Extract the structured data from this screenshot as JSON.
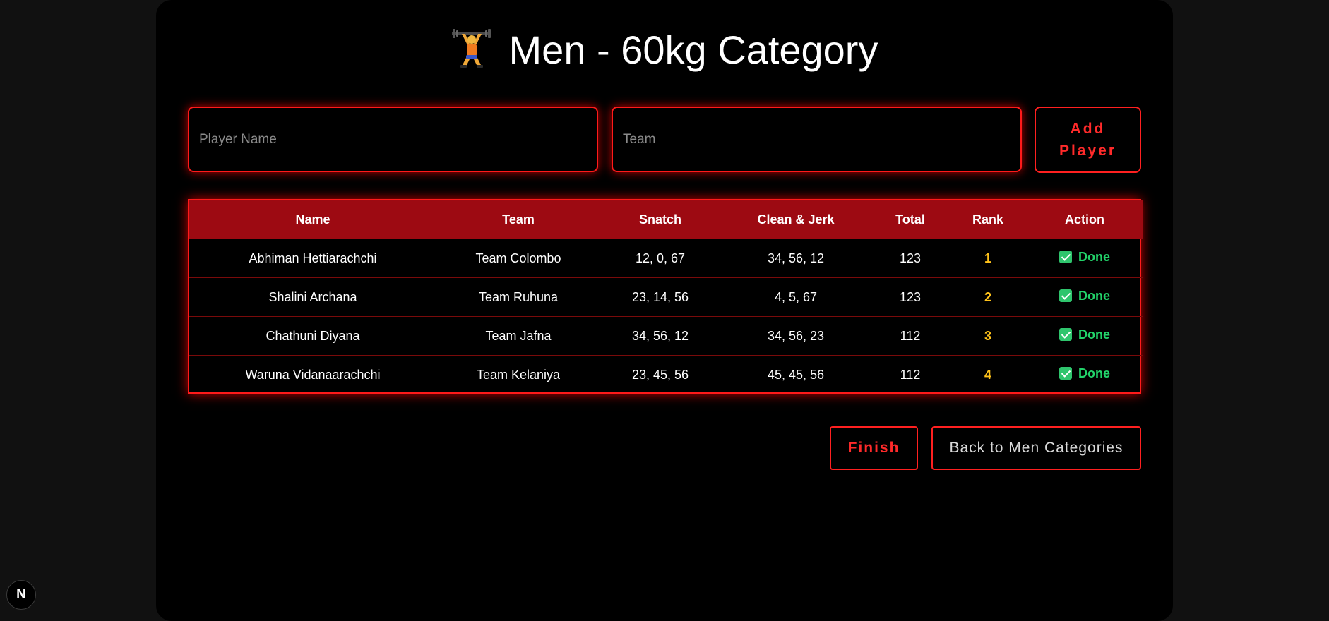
{
  "page": {
    "title": "Men - 60kg Category",
    "title_icon": "weightlifter-emoji"
  },
  "form": {
    "name_placeholder": "Player Name",
    "name_value": "",
    "team_placeholder": "Team",
    "team_value": "",
    "add_label": "Add Player"
  },
  "table": {
    "headers": [
      "Name",
      "Team",
      "Snatch",
      "Clean & Jerk",
      "Total",
      "Rank",
      "Action"
    ],
    "rows": [
      {
        "name": "Abhiman Hettiarachchi",
        "team": "Team Colombo",
        "snatch": "12, 0, 67",
        "clean_jerk": "34, 56, 12",
        "total": "123",
        "rank": "1",
        "action": "Done"
      },
      {
        "name": "Shalini Archana",
        "team": "Team Ruhuna",
        "snatch": "23, 14, 56",
        "clean_jerk": "4, 5, 67",
        "total": "123",
        "rank": "2",
        "action": "Done"
      },
      {
        "name": "Chathuni Diyana",
        "team": "Team Jafna",
        "snatch": "34, 56, 12",
        "clean_jerk": "34, 56, 23",
        "total": "112",
        "rank": "3",
        "action": "Done"
      },
      {
        "name": "Waruna Vidanaarachchi",
        "team": "Team Kelaniya",
        "snatch": "23, 45, 56",
        "clean_jerk": "45, 45, 56",
        "total": "112",
        "rank": "4",
        "action": "Done"
      }
    ]
  },
  "buttons": {
    "finish": "Finish",
    "back": "Back to Men Categories"
  },
  "badge": {
    "label": "N"
  },
  "colors": {
    "accent_red": "#ff1a1a",
    "header_red": "#9d0a12",
    "rank_gold": "#ffc21a",
    "done_green": "#22d36a"
  }
}
